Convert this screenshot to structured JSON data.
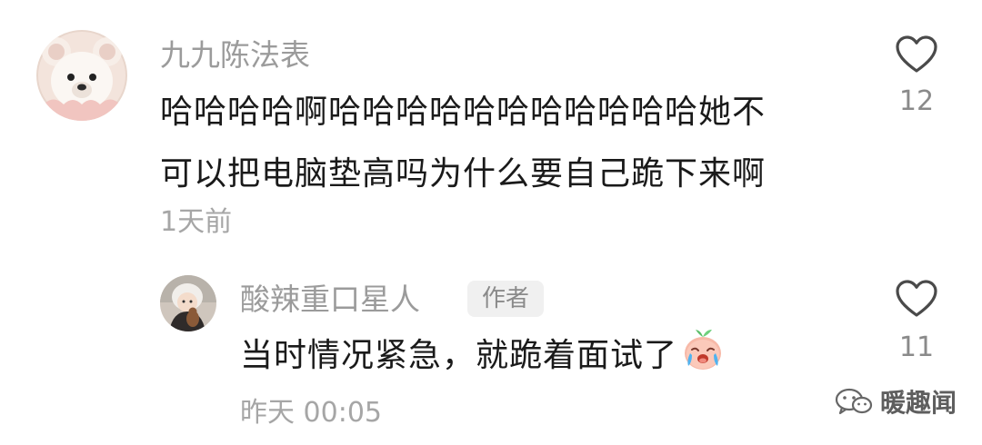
{
  "comments": [
    {
      "username": "九九陈法表",
      "text_lines": [
        "哈哈哈哈啊哈哈哈哈哈哈哈哈哈哈哈她不",
        "可以把电脑垫高吗为什么要自己跪下来啊"
      ],
      "timestamp": "1天前",
      "likes": "12",
      "avatar_icon": "bear-avatar-icon"
    },
    {
      "username": "酸辣重口星人",
      "badge": "作者",
      "text": "当时情况紧急，就跪着面试了",
      "emoji": "crying-face-emoji",
      "timestamp": "昨天 00:05",
      "likes": "11",
      "avatar_icon": "child-photo-avatar-icon"
    }
  ],
  "like_icon": "heart-outline-icon",
  "watermark": {
    "icon": "wechat-logo-icon",
    "text": "暖趣闻"
  },
  "colors": {
    "username": "#9b9b9b",
    "text": "#1a1a1a",
    "meta": "#a6a6a6",
    "badge_bg": "#f0f0f0"
  }
}
